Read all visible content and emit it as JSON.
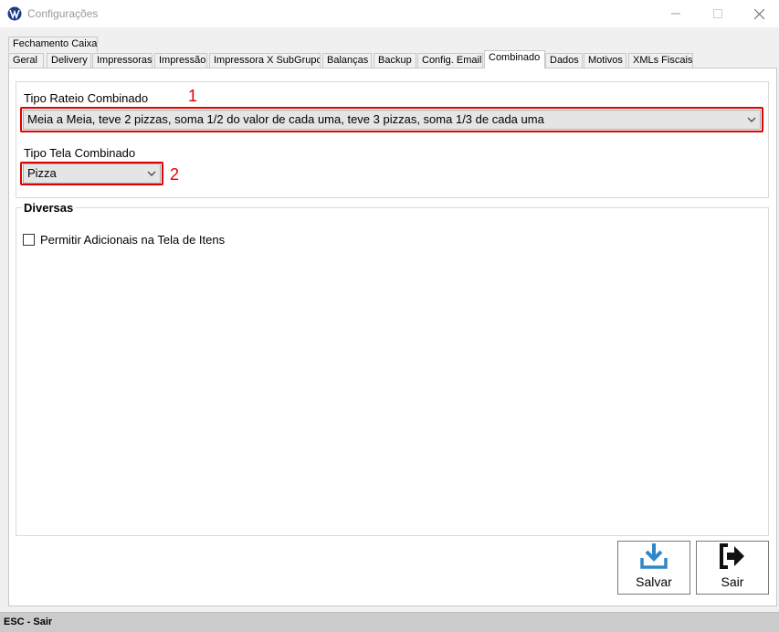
{
  "window": {
    "title": "Configurações",
    "minimize": "—",
    "maximize": "☐",
    "close": "✕"
  },
  "tabs": {
    "top_row": [
      "Fechamento Caixa"
    ],
    "bottom_row": [
      "Geral",
      "Delivery",
      "Impressoras",
      "Impressão",
      "Impressora X SubGrupo",
      "Balanças",
      "Backup",
      "Config. Email",
      "Combinado",
      "Dados",
      "Motivos",
      "XMLs Fiscais"
    ],
    "active": "Combinado"
  },
  "combinado": {
    "rateio_label": "Tipo Rateio Combinado",
    "rateio_value": "Meia a Meia, teve 2 pizzas, soma 1/2 do valor de cada uma, teve 3 pizzas, soma 1/3 de cada uma",
    "tela_label": "Tipo Tela Combinado",
    "tela_value": "Pizza",
    "marker_1": "1",
    "marker_2": "2"
  },
  "diversas": {
    "title": "Diversas",
    "permitir_adicionais": "Permitir Adicionais na Tela de Itens",
    "permitir_adicionais_checked": false
  },
  "buttons": {
    "salvar": "Salvar",
    "sair": "Sair",
    "salvar_icon": "download-icon",
    "sair_icon": "exit-arrow-icon",
    "icon_color": "#2e87c8"
  },
  "status": {
    "text": "ESC - Sair"
  }
}
